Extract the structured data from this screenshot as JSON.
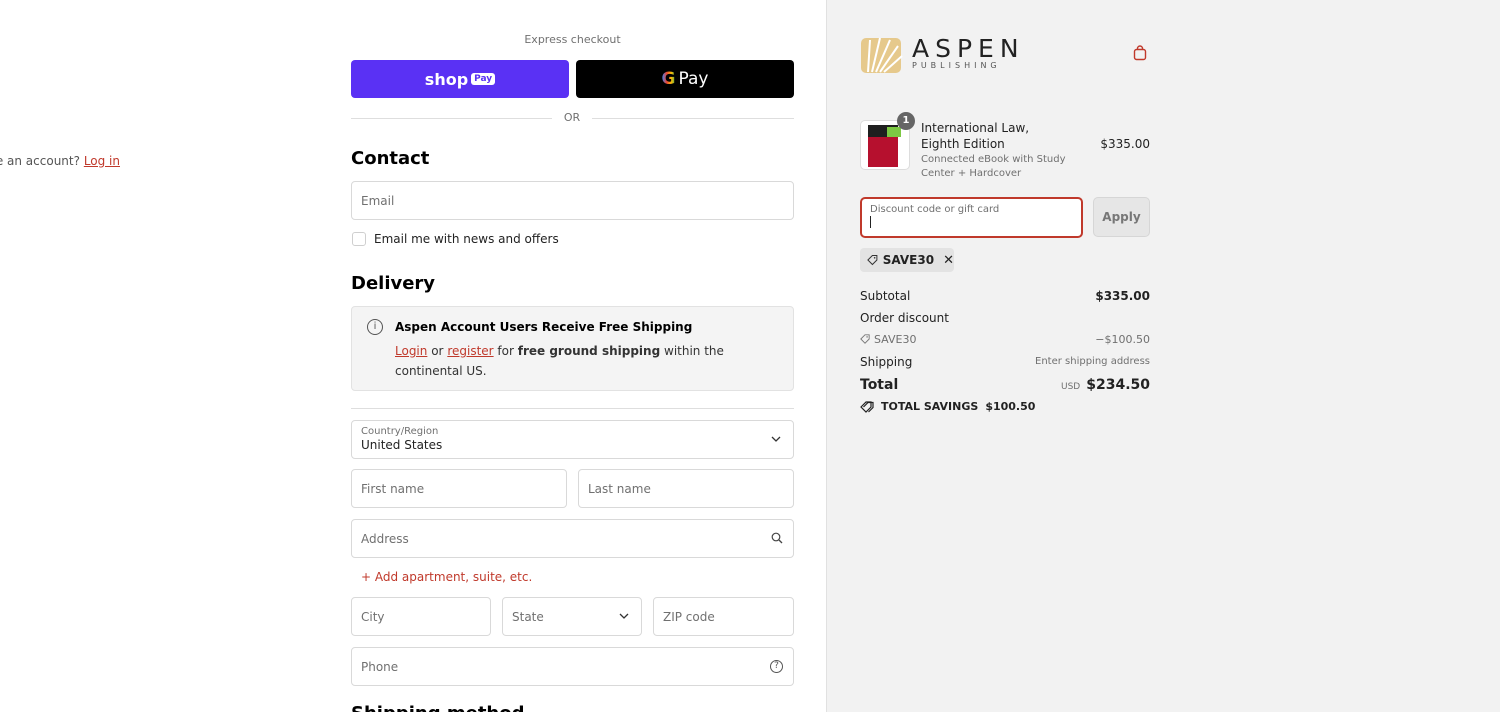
{
  "express": {
    "label": "Express checkout",
    "shop_pay": "shop",
    "shop_pay_badge": "Pay",
    "google_pay": "Pay",
    "google_g": "G",
    "or": "OR"
  },
  "contact": {
    "heading": "Contact",
    "have_account": "Have an account?",
    "login_link": "Log in",
    "email_placeholder": "Email",
    "newsletter_label": "Email me with news and offers"
  },
  "delivery": {
    "heading": "Delivery",
    "notice_title": "Aspen Account Users Receive Free Shipping",
    "notice_login": "Login",
    "notice_or": "or",
    "notice_register": "register",
    "notice_for": "for",
    "notice_bold": "free ground shipping",
    "notice_tail": "within the continental US.",
    "country_label": "Country/Region",
    "country_value": "United States",
    "first_name": "First name",
    "last_name": "Last name",
    "address": "Address",
    "add_apartment": "+ Add apartment, suite, etc.",
    "city": "City",
    "state": "State",
    "zip": "ZIP code",
    "phone": "Phone",
    "help_glyph": "?"
  },
  "shipping_method": {
    "heading": "Shipping method"
  },
  "brand": {
    "name": "ASPEN",
    "sub": "PUBLISHING"
  },
  "cart": {
    "quantity": "1",
    "product_name": "International Law, Eighth Edition",
    "product_variant": "Connected eBook with Study Center + Hardcover",
    "product_price": "$335.00"
  },
  "discount": {
    "placeholder": "Discount code or gift card",
    "apply": "Apply",
    "code": "SAVE30",
    "remove": "✕"
  },
  "summary": {
    "subtotal_label": "Subtotal",
    "subtotal_value": "$335.00",
    "order_discount_label": "Order discount",
    "discount_code": "SAVE30",
    "discount_value": "−$100.50",
    "shipping_label": "Shipping",
    "shipping_value": "Enter shipping address",
    "total_label": "Total",
    "currency": "USD",
    "total_value": "$234.50",
    "savings_label": "TOTAL SAVINGS",
    "savings_value": "$100.50"
  },
  "colors": {
    "shop_pay": "#5a31f4",
    "accent_red": "#c0392b",
    "logo_gold": "#d9b26a"
  },
  "icons": [
    "info-icon",
    "chevron-down-icon",
    "search-icon",
    "help-icon",
    "bag-icon",
    "tag-icon",
    "close-icon"
  ]
}
